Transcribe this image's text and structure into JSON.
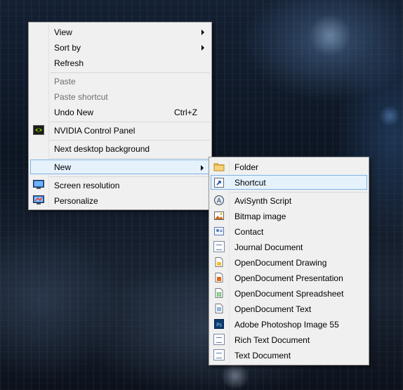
{
  "colors": {
    "menu_bg": "#f0f0f0",
    "highlight_bg": "#e5f1fb",
    "highlight_border": "#7fb4e5",
    "disabled_text": "#6d6d6d"
  },
  "context_menu": {
    "items": [
      {
        "label": "View",
        "has_submenu": true
      },
      {
        "label": "Sort by",
        "has_submenu": true
      },
      {
        "label": "Refresh"
      },
      {
        "label": "Paste",
        "disabled": true
      },
      {
        "label": "Paste shortcut",
        "disabled": true
      },
      {
        "label": "Undo New",
        "shortcut": "Ctrl+Z"
      },
      {
        "label": "NVIDIA Control Panel",
        "icon": "nvidia-icon"
      },
      {
        "label": "Next desktop background"
      },
      {
        "label": "New",
        "has_submenu": true,
        "highlighted": true
      },
      {
        "label": "Screen resolution",
        "icon": "display-icon"
      },
      {
        "label": "Personalize",
        "icon": "personalize-icon"
      }
    ]
  },
  "new_submenu": {
    "items": [
      {
        "label": "Folder",
        "icon": "folder-icon"
      },
      {
        "label": "Shortcut",
        "icon": "shortcut-icon",
        "highlighted": true
      },
      {
        "label": "AviSynth Script",
        "icon": "avisynth-icon"
      },
      {
        "label": "Bitmap image",
        "icon": "bitmap-icon"
      },
      {
        "label": "Contact",
        "icon": "contact-icon"
      },
      {
        "label": "Journal Document",
        "icon": "journal-icon"
      },
      {
        "label": "OpenDocument Drawing",
        "icon": "odg-icon"
      },
      {
        "label": "OpenDocument Presentation",
        "icon": "odp-icon"
      },
      {
        "label": "OpenDocument Spreadsheet",
        "icon": "ods-icon"
      },
      {
        "label": "OpenDocument Text",
        "icon": "odt-icon"
      },
      {
        "label": "Adobe Photoshop Image 55",
        "icon": "photoshop-icon"
      },
      {
        "label": "Rich Text Document",
        "icon": "rtf-icon"
      },
      {
        "label": "Text Document",
        "icon": "txt-icon"
      }
    ]
  }
}
